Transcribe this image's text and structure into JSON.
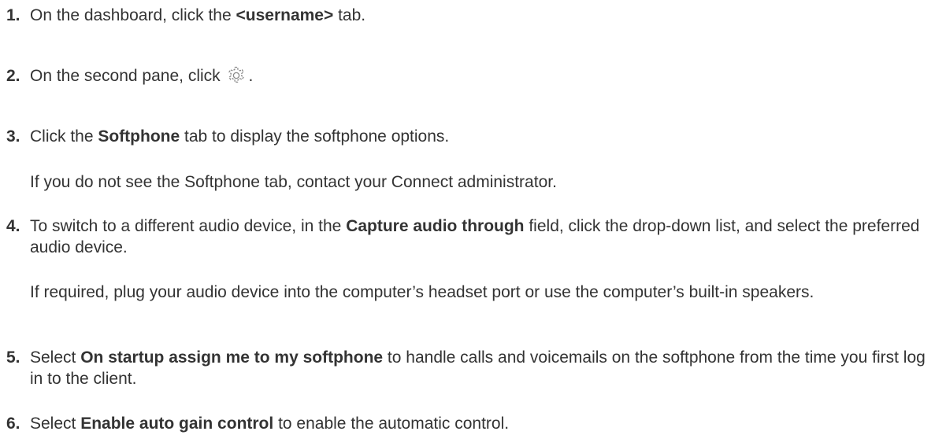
{
  "steps": [
    {
      "number": "1.",
      "text_before": "On the dashboard, click the ",
      "bold": "<username>",
      "text_after": " tab."
    },
    {
      "number": "2.",
      "text_before": "On the second pane, click ",
      "icon": "gear-icon",
      "text_after": "."
    },
    {
      "number": "3.",
      "text_before": "Click the ",
      "bold": "Softphone",
      "text_after": " tab to display the softphone options.",
      "note": "If you do not see the Softphone tab, contact your Connect administrator."
    },
    {
      "number": "4.",
      "text_before": "To switch to a different audio device, in the ",
      "bold": "Capture audio through",
      "text_after": " field, click the drop-down list, and select the preferred audio device.",
      "note": "If required, plug your audio device into the computer’s headset port or use the computer’s built-in speakers."
    },
    {
      "number": "5.",
      "text_before": "Select ",
      "bold": "On startup assign me to my softphone",
      "text_after": " to handle calls and voicemails on the softphone from the time you first log in to the client."
    },
    {
      "number": "6.",
      "text_before": "Select ",
      "bold": "Enable auto gain control",
      "text_after": " to enable the automatic control."
    }
  ],
  "colors": {
    "text": "#333333",
    "icon_stroke": "#8a8a8a"
  }
}
